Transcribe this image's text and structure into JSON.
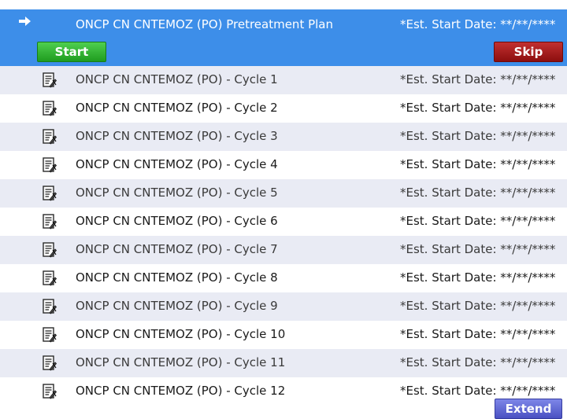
{
  "plan": {
    "title": "ONCP CN CNTEMOZ (PO) Pretreatment Plan",
    "est_start": "*Est. Start Date: **/**/****",
    "start_label": "Start",
    "skip_label": "Skip"
  },
  "cycles": [
    {
      "label": "ONCP CN CNTEMOZ (PO) - Cycle 1",
      "est_start": "*Est. Start Date: **/**/****"
    },
    {
      "label": "ONCP CN CNTEMOZ (PO) - Cycle 2",
      "est_start": "*Est. Start Date: **/**/****"
    },
    {
      "label": "ONCP CN CNTEMOZ (PO) - Cycle 3",
      "est_start": "*Est. Start Date: **/**/****"
    },
    {
      "label": "ONCP CN CNTEMOZ (PO) - Cycle 4",
      "est_start": "*Est. Start Date: **/**/****"
    },
    {
      "label": "ONCP CN CNTEMOZ (PO) - Cycle 5",
      "est_start": "*Est. Start Date: **/**/****"
    },
    {
      "label": "ONCP CN CNTEMOZ (PO) - Cycle 6",
      "est_start": "*Est. Start Date: **/**/****"
    },
    {
      "label": "ONCP CN CNTEMOZ (PO) - Cycle 7",
      "est_start": "*Est. Start Date: **/**/****"
    },
    {
      "label": "ONCP CN CNTEMOZ (PO) - Cycle 8",
      "est_start": "*Est. Start Date: **/**/****"
    },
    {
      "label": "ONCP CN CNTEMOZ (PO) - Cycle 9",
      "est_start": "*Est. Start Date: **/**/****"
    },
    {
      "label": "ONCP CN CNTEMOZ (PO) - Cycle 10",
      "est_start": "*Est. Start Date: **/**/****"
    },
    {
      "label": "ONCP CN CNTEMOZ (PO) - Cycle 11",
      "est_start": "*Est. Start Date: **/**/****"
    },
    {
      "label": "ONCP CN CNTEMOZ (PO) - Cycle 12",
      "est_start": "*Est. Start Date: **/**/****"
    }
  ],
  "footer": {
    "extend_label": "Extend"
  },
  "icons": {
    "selected_row": "arrow-right-icon",
    "cycle_row": "document-icon"
  },
  "colors": {
    "selection": "#3d8ee9",
    "start": "#2fb12f",
    "skip": "#a01515",
    "extend": "#5b62d6",
    "alt_row": "#e9ebf4"
  }
}
